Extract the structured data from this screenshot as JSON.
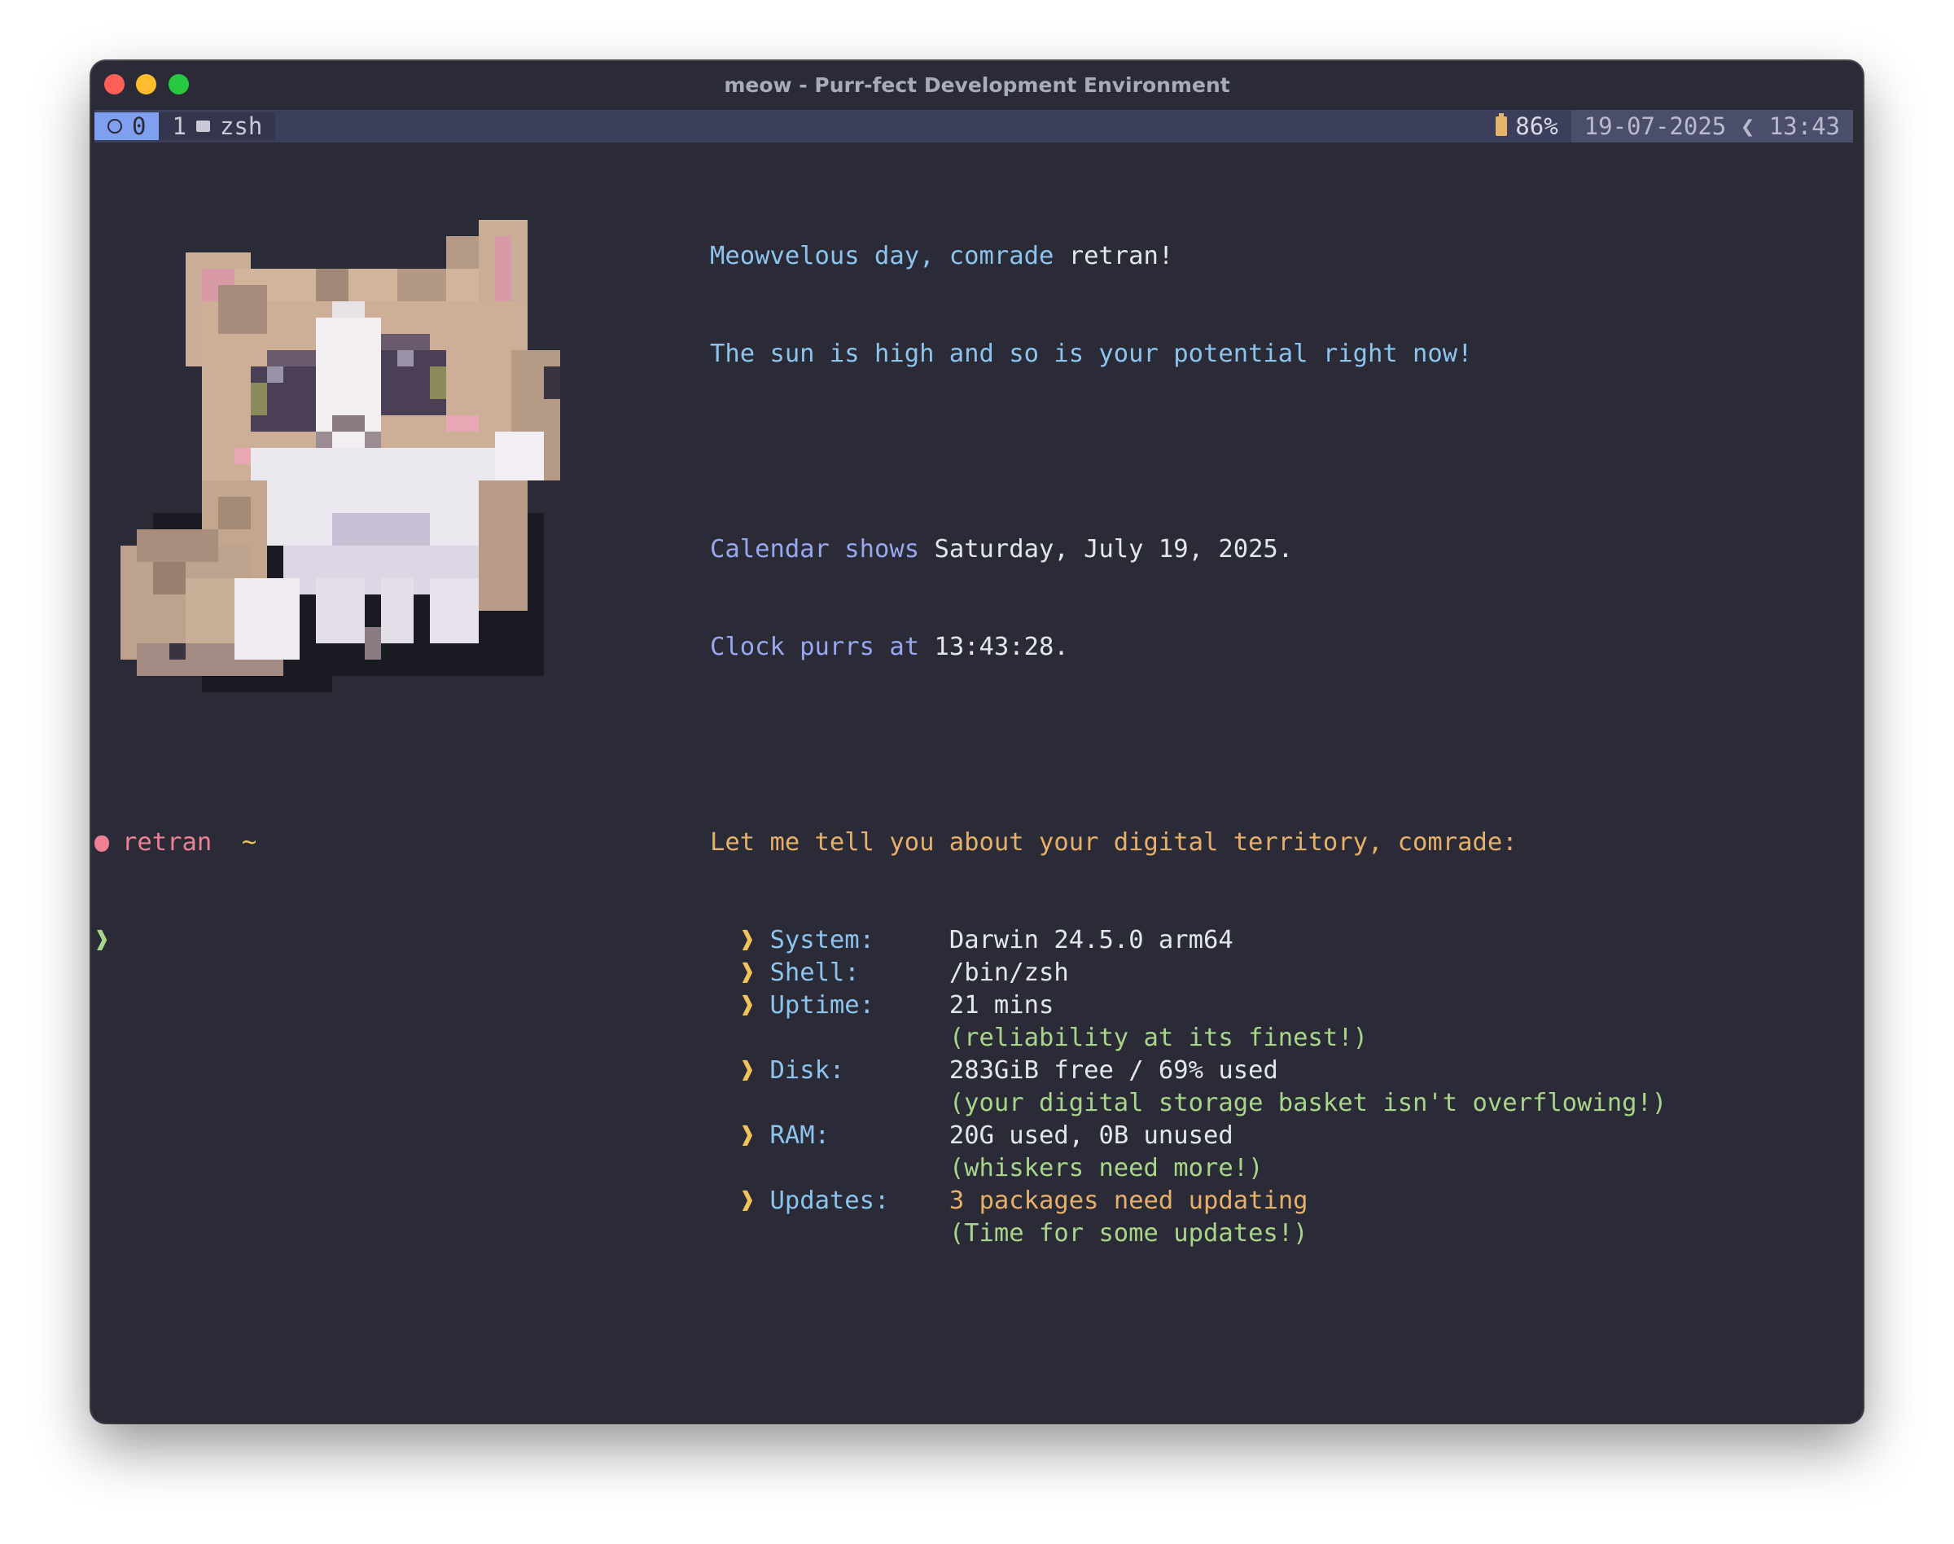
{
  "window": {
    "title": "meow - Purr-fect Development Environment"
  },
  "tmux": {
    "session_index": "0",
    "window_index": "1",
    "window_name": "zsh",
    "battery": "86%",
    "date": "19-07-2025",
    "separator": "❮",
    "time": "13:43"
  },
  "greeting": {
    "line1_prefix": "Meowvelous day, comrade ",
    "user": "retran!",
    "line2": "The sun is high and so is your potential right now!"
  },
  "calendar": {
    "label": "Calendar shows ",
    "value": "Saturday, July 19, 2025."
  },
  "clock": {
    "label": "Clock purrs at ",
    "value": "13:43:28."
  },
  "territory_header": "Let me tell you about your digital territory, comrade:",
  "bullet": "❱",
  "info": [
    {
      "label": "System:",
      "value": "Darwin 24.5.0 arm64",
      "note": ""
    },
    {
      "label": "Shell:",
      "value": "/bin/zsh",
      "note": ""
    },
    {
      "label": "Uptime:",
      "value": "21 mins",
      "note": "(reliability at its finest!)"
    },
    {
      "label": "Disk:",
      "value": "283GiB free / 69% used",
      "note": "(your digital storage basket isn't overflowing!)"
    },
    {
      "label": "RAM:",
      "value": "20G used, 0B unused",
      "note": "(whiskers need more!)"
    },
    {
      "label": "Updates:",
      "value": "3 packages need updating",
      "note": "(Time for some updates!)"
    }
  ],
  "prompt": {
    "user": "retran",
    "path": "~",
    "symbol": "❱"
  },
  "colors": {
    "background": "#2a2b36",
    "accent_blue": "#8cc4ee",
    "accent_orange": "#e7b06a",
    "accent_green": "#a9d58a",
    "accent_pink": "#ee7f95"
  },
  "icons": {
    "window_controls": [
      "close-icon",
      "minimize-icon",
      "maximize-icon"
    ],
    "status": [
      "circle-icon",
      "terminal-icon",
      "battery-icon"
    ],
    "prompt": "apple-icon",
    "art": "pixel-cat"
  }
}
